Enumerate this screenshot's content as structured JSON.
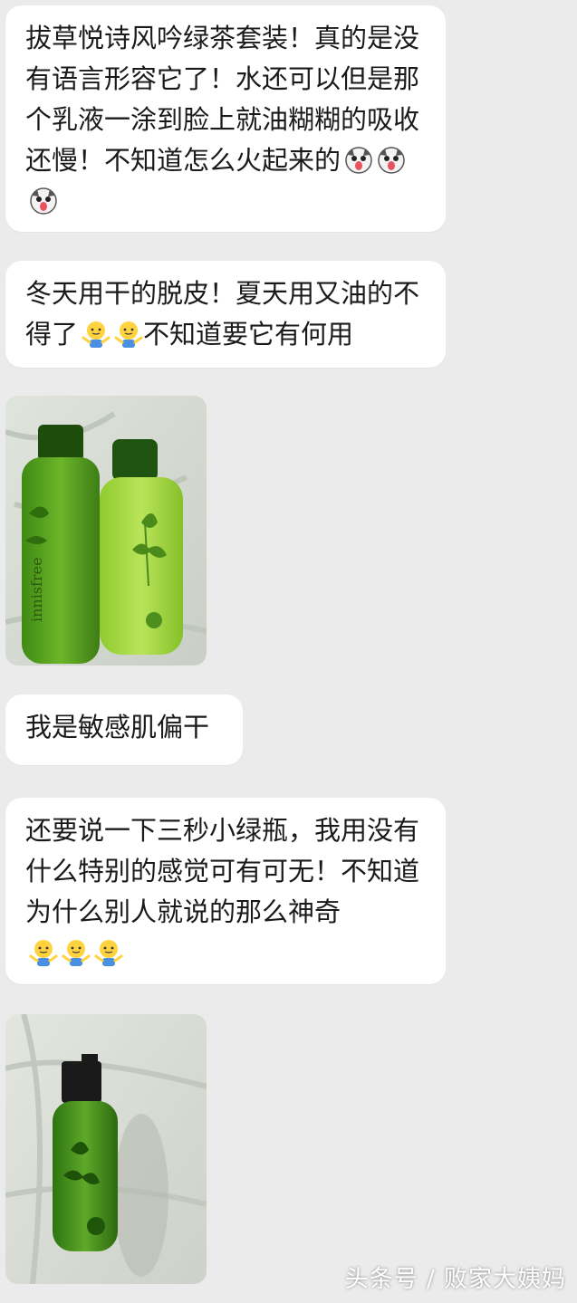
{
  "messages": [
    {
      "text": "拔草悦诗风吟绿茶套装！真的是没有语言形容它了！水还可以但是那个乳液一涂到脸上就油糊糊的吸收还慢！不知道怎么火起来的",
      "emoji": "tongue-face-emoji"
    },
    {
      "text": "冬天用干的脱皮！夏天用又油的不得了",
      "text2": "不知道要它有何用",
      "emoji": "shrug-emoji"
    },
    {
      "image": "innisfree-green-tea-bottles-photo",
      "bottle_label": "innisfree"
    },
    {
      "text": "我是敏感肌偏干"
    },
    {
      "text": "还要说一下三秒小绿瓶，我用没有什么特别的感觉可有可无！不知道为什么别人就说的那么神奇",
      "emoji": "shrug-emoji"
    },
    {
      "image": "innisfree-green-serum-bottle-photo"
    }
  ],
  "watermark": "头条号 / 败家大姨妈",
  "colors": {
    "background": "#ebebeb",
    "bubble": "#ffffff",
    "bottle_green": "#5fa51f"
  }
}
